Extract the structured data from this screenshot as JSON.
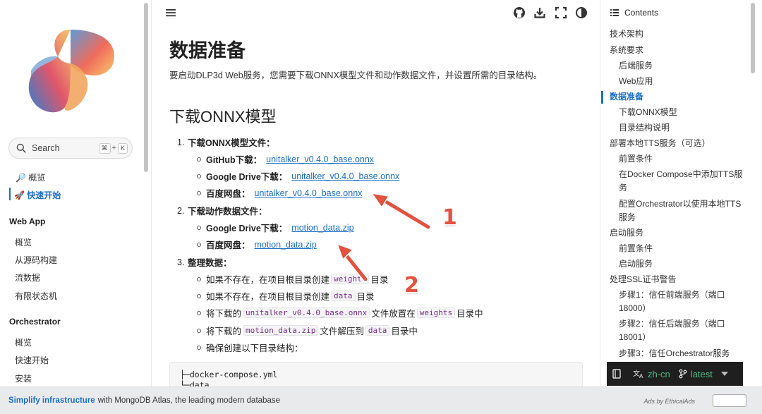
{
  "sidebar": {
    "search_label": "Search",
    "shortcut": [
      "⌘",
      "K"
    ],
    "top_items": [
      {
        "icon": "magnifier-icon",
        "label": "概览"
      },
      {
        "icon": "rocket-icon",
        "label": "快速开始"
      }
    ],
    "groups": [
      {
        "title": "Web App",
        "items": [
          "概览",
          "从源码构建",
          "流数据",
          "有限状态机"
        ]
      },
      {
        "title": "Orchestrator",
        "items": [
          "概览",
          "快速开始",
          "安装"
        ]
      }
    ]
  },
  "main": {
    "page_title": "数据准备",
    "intro": "要启动DLP3d Web服务，您需要下载ONNX模型文件和动作数据文件，并设置所需的目录结构。",
    "section_title": "下载ONNX模型",
    "steps": [
      {
        "num": "1.",
        "title": "下载ONNX模型文件：",
        "subs": [
          {
            "label": "GitHub下载：",
            "link": "unitalker_v0.4.0_base.onnx"
          },
          {
            "label": "Google Drive下载：",
            "link": "unitalker_v0.4.0_base.onnx"
          },
          {
            "label": "百度网盘：",
            "link": "unitalker_v0.4.0_base.onnx"
          }
        ]
      },
      {
        "num": "2.",
        "title": "下载动作数据文件：",
        "subs": [
          {
            "label": "Google Drive下载：",
            "link": "motion_data.zip"
          },
          {
            "label": "百度网盘：",
            "link": "motion_data.zip"
          }
        ]
      },
      {
        "num": "3.",
        "title": "整理数据：",
        "subs": [
          {
            "parts": [
              "如果不存在，在项目根目录创建",
              "weights",
              "目录"
            ]
          },
          {
            "parts": [
              "如果不存在，在项目根目录创建",
              "data",
              "目录"
            ]
          },
          {
            "parts": [
              "将下载的",
              "unitalker_v0.4.0_base.onnx",
              "文件放置在",
              "weights",
              "目录中"
            ]
          },
          {
            "parts": [
              "将下载的",
              "motion_data.zip",
              "文件解压到",
              "data",
              "目录中"
            ]
          },
          {
            "parts": [
              "确保创建以下目录结构："
            ]
          }
        ]
      }
    ],
    "code_lines": [
      "├─docker-compose.yml",
      "└─data"
    ],
    "annotations": [
      "1",
      "2"
    ]
  },
  "toc": {
    "title": "Contents",
    "items": [
      {
        "label": "技术架构",
        "level": 0
      },
      {
        "label": "系统要求",
        "level": 0
      },
      {
        "label": "后端服务",
        "level": 1
      },
      {
        "label": "Web应用",
        "level": 1
      },
      {
        "label": "数据准备",
        "level": 0,
        "active": true
      },
      {
        "label": "下载ONNX模型",
        "level": 1
      },
      {
        "label": "目录结构说明",
        "level": 1
      },
      {
        "label": "部署本地TTS服务（可选）",
        "level": 0
      },
      {
        "label": "前置条件",
        "level": 1
      },
      {
        "label": "在Docker Compose中添加TTS服务",
        "level": 1,
        "lines": 2
      },
      {
        "label": "配置Orchestrator以使用本地TTS服务",
        "level": 1,
        "lines": 2
      },
      {
        "label": "启动服务",
        "level": 0
      },
      {
        "label": "前置条件",
        "level": 1
      },
      {
        "label": "启动服务",
        "level": 1
      },
      {
        "label": "处理SSL证书警告",
        "level": 0
      },
      {
        "label": "步骤1：信任前端服务（端口18000）",
        "level": 1,
        "lines": 2
      },
      {
        "label": "步骤2：信任后端服务（端口18001）",
        "level": 1,
        "lines": 2
      },
      {
        "label": "步骤3：信任Orchestrator服务",
        "level": 1
      }
    ]
  },
  "langbar": {
    "lang": "zh-cn",
    "version": "latest"
  },
  "ad": {
    "strong": "Simplify infrastructure",
    "text": "with MongoDB Atlas, the leading modern database",
    "by": "Ads by EthicalAds"
  },
  "colors": {
    "accent": "#1a6fc9",
    "annotation": "#e3513f",
    "code_text": "#7b2a8e"
  }
}
